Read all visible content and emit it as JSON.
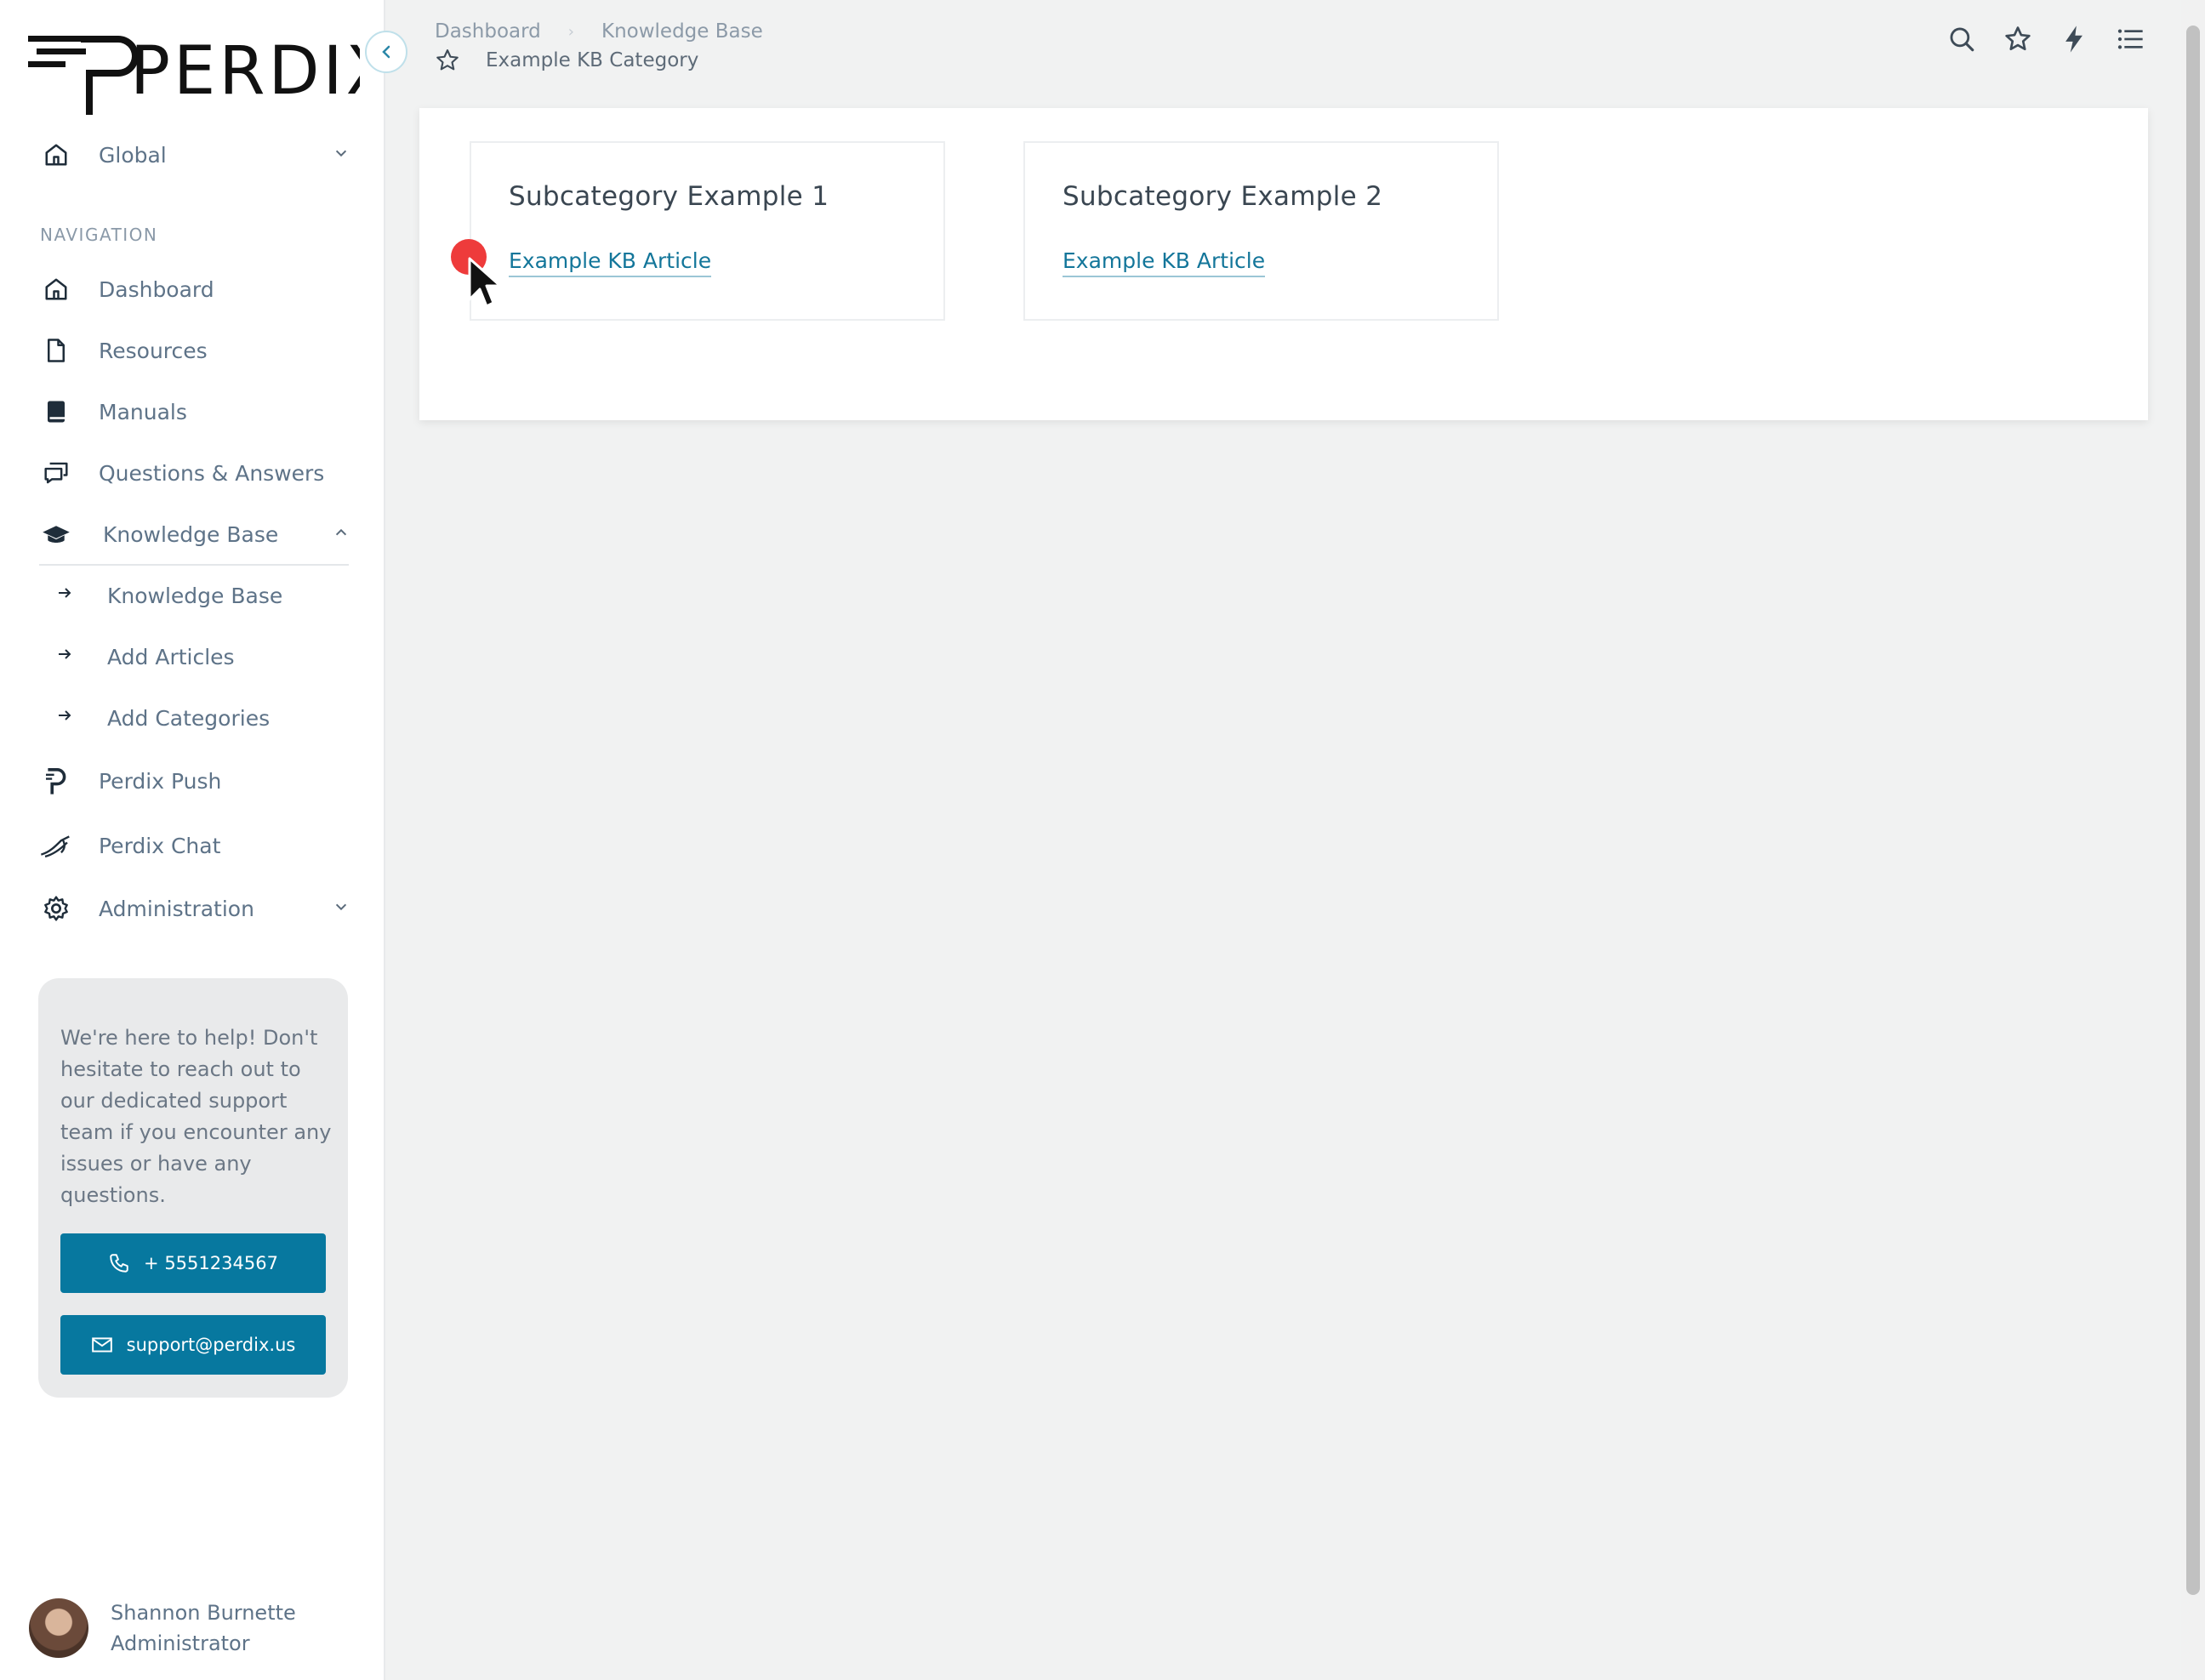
{
  "brand": {
    "logo_text": "PERDIX"
  },
  "colors": {
    "accent": "#07789f",
    "link": "#13769a",
    "click_marker": "#ee3b3b"
  },
  "sidebar": {
    "workspace": {
      "label": "Global",
      "icon": "home-icon"
    },
    "section_title": "NAVIGATION",
    "items": [
      {
        "label": "Dashboard",
        "icon": "home-icon"
      },
      {
        "label": "Resources",
        "icon": "file-icon"
      },
      {
        "label": "Manuals",
        "icon": "book-icon"
      },
      {
        "label": "Questions & Answers",
        "icon": "chat-icon"
      },
      {
        "label": "Knowledge Base",
        "icon": "graduation-cap-icon",
        "expanded": true
      },
      {
        "label": "Perdix Push",
        "icon": "perdix-push-icon"
      },
      {
        "label": "Perdix Chat",
        "icon": "bird-icon"
      },
      {
        "label": "Administration",
        "icon": "gear-icon"
      }
    ],
    "sub_items": [
      {
        "label": "Knowledge Base"
      },
      {
        "label": "Add Articles"
      },
      {
        "label": "Add Categories"
      }
    ],
    "help": {
      "text": "We're here to help! Don't hesitate to reach out to our dedicated support team if you encounter any issues or have any questions.",
      "phone": "+ 5551234567",
      "email": "support@perdix.us"
    },
    "user": {
      "name": "Shannon Burnette",
      "role": "Administrator"
    }
  },
  "header": {
    "breadcrumb": [
      "Dashboard",
      "Knowledge Base"
    ],
    "title": "Example KB Category",
    "tools": [
      "search-icon",
      "star-icon",
      "lightning-icon",
      "list-icon"
    ]
  },
  "main": {
    "subcategories": [
      {
        "title": "Subcategory Example 1",
        "articles": [
          "Example KB Article"
        ]
      },
      {
        "title": "Subcategory Example 2",
        "articles": [
          "Example KB Article"
        ]
      }
    ]
  }
}
